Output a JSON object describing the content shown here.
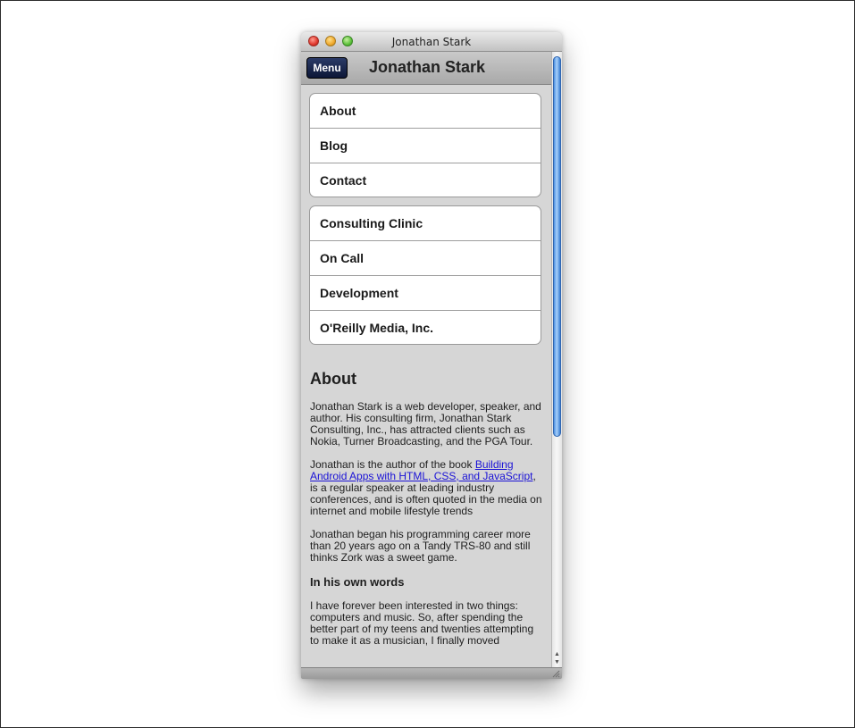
{
  "window": {
    "title": "Jonathan Stark"
  },
  "toolbar": {
    "menu_label": "Menu",
    "title": "Jonathan Stark"
  },
  "nav": {
    "group1": [
      {
        "label": "About"
      },
      {
        "label": "Blog"
      },
      {
        "label": "Contact"
      }
    ],
    "group2": [
      {
        "label": "Consulting Clinic"
      },
      {
        "label": "On Call"
      },
      {
        "label": "Development"
      },
      {
        "label": "O'Reilly Media, Inc."
      }
    ]
  },
  "article": {
    "heading": "About",
    "p1": "Jonathan Stark is a web developer, speaker, and author. His consulting firm, Jonathan Stark Consulting, Inc., has attracted clients such as Nokia, Turner Broadcasting, and the PGA Tour.",
    "p2_before": "Jonathan is the author of the book ",
    "p2_link": "Building Android Apps with HTML, CSS, and JavaScript",
    "p2_after": ", is a regular speaker at leading industry conferences, and is often quoted in the media on internet and mobile lifestyle trends",
    "p3": "Jonathan began his programming career more than 20 years ago on a Tandy TRS-80 and still thinks Zork was a sweet game.",
    "subheading": "In his own words",
    "p4": "I have forever been interested in two things: computers and music. So, after spending the better part of my teens and twenties attempting to make it as a musician, I finally moved"
  },
  "icons": {
    "close": "close-circle-icon",
    "minimize": "minimize-circle-icon",
    "zoom": "zoom-circle-icon",
    "scroll_up": "scroll-up-arrow-icon",
    "scroll_down": "scroll-down-arrow-icon",
    "resize": "resize-grip-icon"
  },
  "colors": {
    "menu_button": "#0c1636",
    "link": "#1a12d6",
    "scroll_thumb": "#4b8fe0"
  },
  "scroll": {
    "thumb_fraction": 0.62,
    "position_fraction": 0
  }
}
